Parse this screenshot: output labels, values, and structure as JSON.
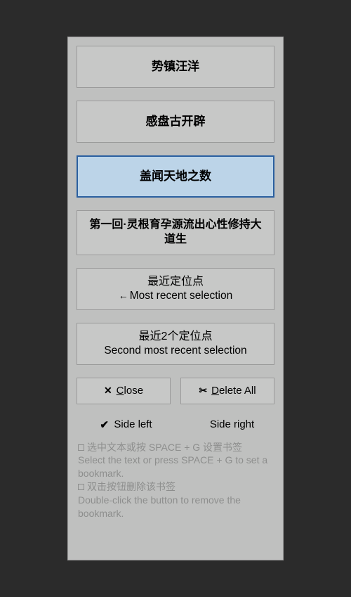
{
  "bookmarks": [
    {
      "label": "势镇汪洋",
      "selected": false
    },
    {
      "label": "感盘古开辟",
      "selected": false
    },
    {
      "label": "盖闻天地之数",
      "selected": true
    },
    {
      "label": "第一回·灵根育孕源流出心性修持大道生",
      "selected": false
    }
  ],
  "recent": [
    {
      "cn": "最近定位点",
      "arrow": "←",
      "en": "Most recent selection"
    },
    {
      "cn": "最近2个定位点",
      "arrow": "",
      "en": "Second most recent selection"
    }
  ],
  "buttons": {
    "close": {
      "icon": "✕",
      "prefix": "C",
      "rest": "lose"
    },
    "deleteAll": {
      "icon": "✂",
      "prefix": "D",
      "rest": "elete All"
    }
  },
  "side": {
    "left": {
      "label": "Side left",
      "checked": true
    },
    "right": {
      "label": "Side right",
      "checked": false
    }
  },
  "hints": {
    "h1cn": "选中文本或按 SPACE + G 设置书签",
    "h1en": "Select the text or press SPACE + G to set a bookmark.",
    "h2cn": "双击按钮删除该书签",
    "h2en": "Double-click the button to remove the bookmark."
  }
}
